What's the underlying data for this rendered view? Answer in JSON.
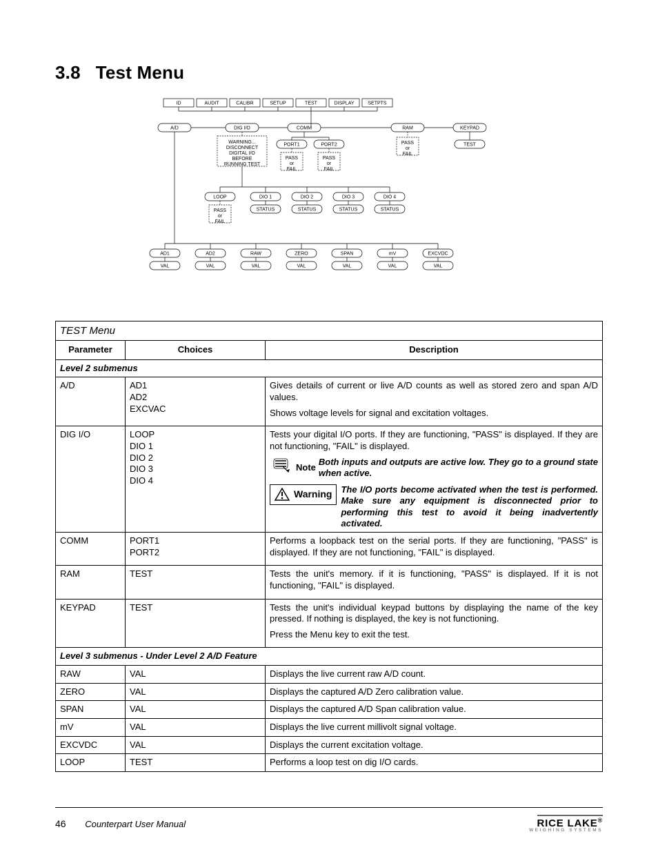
{
  "section": {
    "number": "3.8",
    "title": "Test Menu"
  },
  "diagram": {
    "top_menu": [
      "ID",
      "AUDIT",
      "CALIBR",
      "SETUP",
      "TEST",
      "DISPLAY",
      "SETPTS"
    ],
    "row2": [
      "A/D",
      "DIG I/O",
      "COMM",
      "RAM",
      "KEYPAD"
    ],
    "digio_note": [
      "WARNING...",
      "DISCONNECT",
      "DIGITAL I/O",
      "BEFORE",
      "RUNNING TEST"
    ],
    "comm_children": [
      "PORT1",
      "PORT2"
    ],
    "pass_or_fail": [
      "PASS",
      "or",
      "FAIL"
    ],
    "keypad_child": "TEST",
    "dio_row": [
      "LOOP",
      "DIO 1",
      "DIO 2",
      "DIO 3",
      "DIO 4"
    ],
    "dio_child": "STATUS",
    "ad_row": [
      "AD1",
      "AD2",
      "RAW",
      "ZERO",
      "SPAN",
      "mV",
      "EXCVDC"
    ],
    "ad_child": "VAL"
  },
  "table": {
    "title": "TEST Menu",
    "headers": {
      "param": "Parameter",
      "choices": "Choices",
      "desc": "Description"
    },
    "subhead2": "Level 2 submenus",
    "subhead3": "Level 3 submenus - Under Level 2 A/D Feature",
    "rows2": [
      {
        "param": "A/D",
        "choices": [
          "AD1",
          "AD2",
          "EXCVAC"
        ],
        "desc": [
          "Gives details of current or live A/D counts as well as stored zero and span A/D values.",
          "Shows voltage levels for signal and excitation voltages."
        ]
      },
      {
        "param": "DIG I/O",
        "choices": [
          "LOOP",
          "DIO 1",
          "DIO 2",
          "DIO 3",
          "DIO 4"
        ],
        "desc_intro": "Tests your digital I/O ports. If they are functioning, \"PASS\" is displayed. If they are not functioning, \"FAIL\" is displayed.",
        "note_label": "Note",
        "note": "Both inputs and outputs are active low. They go to a ground state when active.",
        "warn_label": "Warning",
        "warn": "The I/O ports become activated when the test is performed. Make sure any equipment is disconnected prior to performing this test to avoid it being inadvertently activated."
      },
      {
        "param": "COMM",
        "choices": [
          "PORT1",
          "PORT2"
        ],
        "desc": [
          "Performs a loopback test on the serial ports. If they are functioning, \"PASS\" is displayed. If they are not functioning, \"FAIL\" is displayed."
        ]
      },
      {
        "param": "RAM",
        "choices": [
          "TEST"
        ],
        "desc": [
          "Tests the unit's memory. if it is functioning, \"PASS\" is displayed. If it is not functioning, \"FAIL\" is displayed."
        ]
      },
      {
        "param": "KEYPAD",
        "choices": [
          "TEST"
        ],
        "desc": [
          "Tests the unit's individual keypad buttons by displaying the name of the key pressed. If nothing is displayed, the key is not functioning.",
          "Press the Menu key to exit the test."
        ]
      }
    ],
    "rows3": [
      {
        "param": "RAW",
        "choices": "VAL",
        "desc": "Displays the live current raw A/D count."
      },
      {
        "param": "ZERO",
        "choices": "VAL",
        "desc": "Displays the captured A/D Zero calibration value."
      },
      {
        "param": "SPAN",
        "choices": "VAL",
        "desc": "Displays the captured A/D Span calibration value."
      },
      {
        "param": "mV",
        "choices": "VAL",
        "desc": "Displays the live current millivolt signal voltage."
      },
      {
        "param": "EXCVDC",
        "choices": "VAL",
        "desc": "Displays the current excitation voltage."
      },
      {
        "param": "LOOP",
        "choices": "TEST",
        "desc": "Performs a loop test on dig I/O cards."
      }
    ]
  },
  "footer": {
    "page": "46",
    "manual": "Counterpart User Manual",
    "logo_brand": "RICE LAKE",
    "logo_sub": "WEIGHING SYSTEMS"
  }
}
